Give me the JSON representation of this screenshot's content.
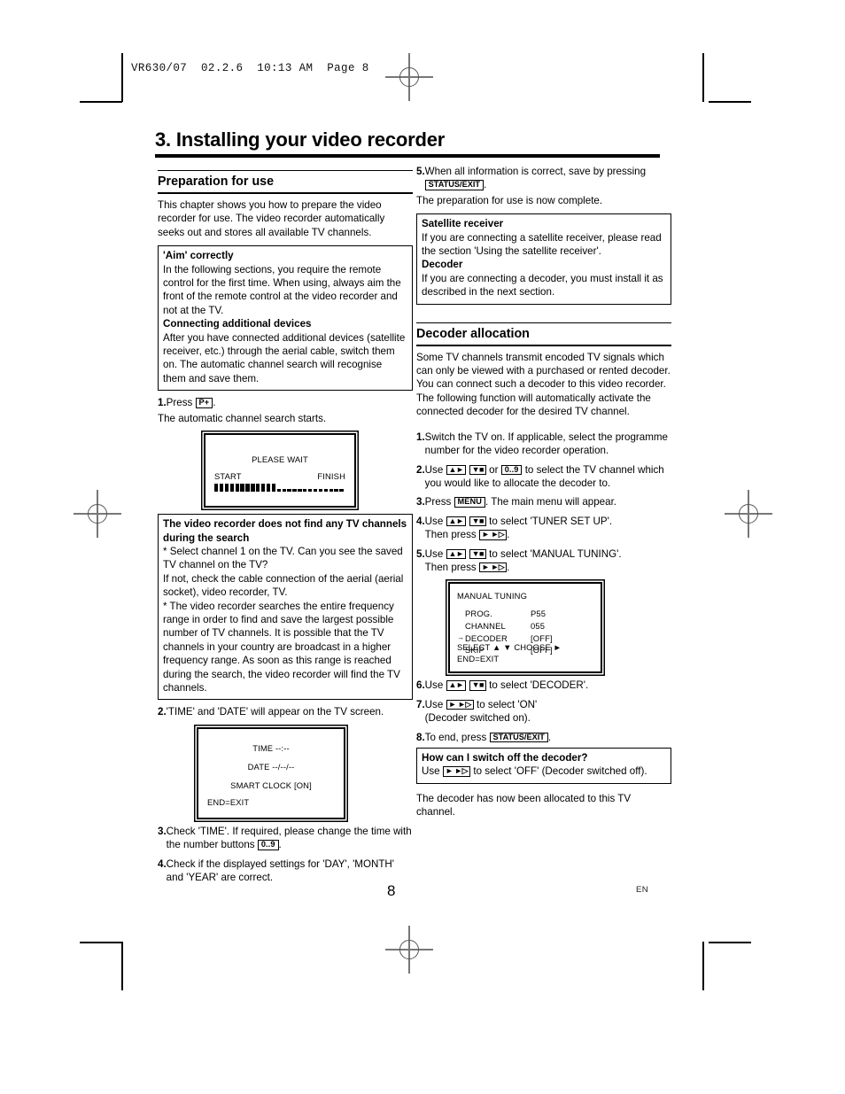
{
  "page": {
    "filestamp": "VR630/07  02.2.6  10:13 AM  Page 8",
    "chapter_title": "3. Installing your video recorder",
    "footer_page_number": "8",
    "footer_language": "EN"
  },
  "left_column": {
    "section_title": "Preparation for use",
    "intro": "This chapter shows you how to prepare the video recorder for use. The video recorder automatically seeks out and stores all available TV channels.",
    "tip_aim": {
      "heading1": "'Aim' correctly",
      "body1": "In the following sections, you require the remote control for the first time. When using, always aim the front of the remote control at the video recorder and not at the TV.",
      "heading2": "Connecting additional devices",
      "body2": "After you have connected additional devices (satellite receiver, etc.) through the aerial cable, switch them on. The automatic channel search will recognise them and save them."
    },
    "step1": {
      "num": "1.",
      "text_before": "Press",
      "key": "P+",
      "text_after": ".",
      "follow": "The automatic channel search starts."
    },
    "screen_search": {
      "title": "PLEASE WAIT",
      "start_label": "START",
      "finish_label": "FINISH",
      "filled_blocks": 12,
      "empty_blocks": 13
    },
    "tip_nochannels": {
      "heading": "The video recorder does not find any TV channels during the search",
      "body1": "* Select channel 1 on the TV. Can you see the saved TV channel on the TV?",
      "body2": "If not, check the cable connection of the aerial (aerial socket), video recorder, TV.",
      "body3": "* The video recorder searches the entire frequency range in order to find and save the largest possible number of TV channels. It is possible that the TV channels in your country are broadcast in a higher frequency range. As soon as this range is reached during the search, the video recorder will find the TV channels."
    },
    "step2": {
      "num": "2.",
      "text": "'TIME' and 'DATE' will appear on the TV screen."
    },
    "screen_time": {
      "line_time": "TIME --:--",
      "line_date": "DATE --/--/--",
      "line_smart": "SMART CLOCK [ON]",
      "line_end": "END=EXIT"
    },
    "step3": {
      "num": "3.",
      "text_before": "Check 'TIME'. If required, please change the time with the number buttons",
      "key": "0..9",
      "text_after": "."
    },
    "step4": {
      "num": "4.",
      "text": "Check if the displayed settings for 'DAY', 'MONTH' and 'YEAR' are correct."
    }
  },
  "right_column": {
    "step5": {
      "num": "5.",
      "text_before": "When all information is correct, save by pressing",
      "key": "STATUS/EXIT",
      "text_after": "."
    },
    "step5_follow": "The preparation for use is now complete.",
    "tip_satellite": {
      "heading1": "Satellite receiver",
      "body1": "If you are connecting a satellite receiver, please read the section 'Using the satellite receiver'.",
      "heading2": "Decoder",
      "body2": "If you are connecting a decoder, you must install it as described in the next section."
    },
    "section_title": "Decoder allocation",
    "intro": "Some TV channels transmit encoded TV signals which can only be viewed with a purchased or rented decoder. You can connect such a decoder to this video recorder. The following function will automatically activate the connected decoder for the desired TV channel.",
    "step1": {
      "num": "1.",
      "text": "Switch the TV on. If applicable, select the programme number for the video recorder operation."
    },
    "step2": {
      "num": "2.",
      "text_a": "Use",
      "key1": "▲►",
      "key2": "▼■",
      "text_b": "or",
      "key3": "0..9",
      "text_c": "to select the TV channel which you would like to allocate the decoder to."
    },
    "step3": {
      "num": "3.",
      "text_a": "Press",
      "key": "MENU",
      "text_b": ". The main menu will appear."
    },
    "step4": {
      "num": "4.",
      "text_a": "Use",
      "key1": "▲►",
      "key2": "▼■",
      "text_b": "to select 'TUNER SET UP'.",
      "text_c": "Then press",
      "key3": "► ►▷",
      "text_d": "."
    },
    "step5b": {
      "num": "5.",
      "text_a": "Use",
      "key1": "▲►",
      "key2": "▼■",
      "text_b": "to select 'MANUAL TUNING'.",
      "text_c": "Then press",
      "key3": "► ►▷",
      "text_d": "."
    },
    "screen_manual": {
      "title": "MANUAL TUNING",
      "rows": [
        {
          "marker": "",
          "label": "PROG.",
          "value": "P55"
        },
        {
          "marker": "",
          "label": "CHANNEL",
          "value": "055"
        },
        {
          "marker": "→",
          "label": "DECODER",
          "value": "[OFF]"
        },
        {
          "marker": "",
          "label": "SKIP",
          "value": "[OFF]"
        }
      ],
      "footer1": "SELECT ▲ ▼  CHOOSE ►",
      "footer2": "END=EXIT"
    },
    "step6": {
      "num": "6.",
      "text_a": "Use",
      "key1": "▲►",
      "key2": "▼■",
      "text_b": "to select 'DECODER'."
    },
    "step7": {
      "num": "7.",
      "text_a": "Use",
      "key1": "► ►▷",
      "text_b": "to select 'ON'",
      "text_c": "(Decoder switched on)."
    },
    "step8": {
      "num": "8.",
      "text_a": "To end, press",
      "key": "STATUS/EXIT",
      "text_b": "."
    },
    "tip_switchoff": {
      "heading": "How can I switch off the decoder?",
      "text_a": "Use",
      "key": "► ►▷",
      "text_b": "to select 'OFF' (Decoder switched off)."
    },
    "closing": "The decoder has now been allocated to this TV channel."
  }
}
